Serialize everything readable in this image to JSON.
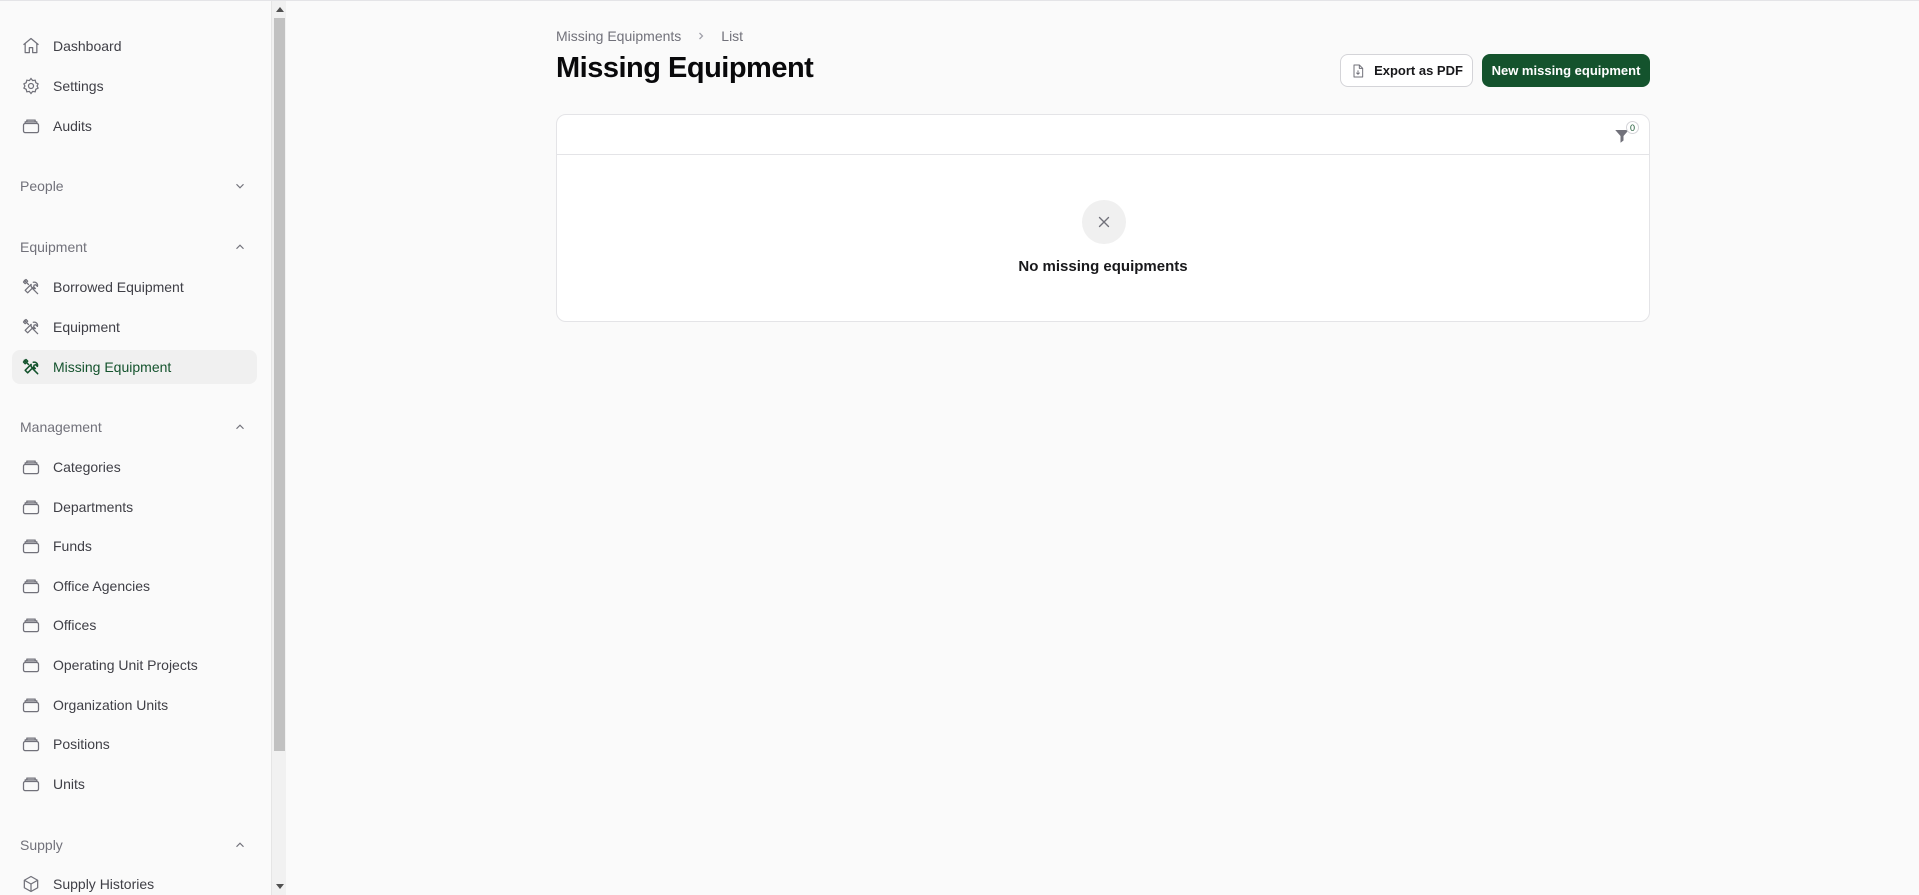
{
  "sidebar": {
    "top_items": [
      {
        "label": "Dashboard",
        "icon": "home-icon"
      },
      {
        "label": "Settings",
        "icon": "settings-icon"
      },
      {
        "label": "Audits",
        "icon": "stack-icon"
      }
    ],
    "groups": {
      "people": {
        "label": "People",
        "expanded": false
      },
      "equipment": {
        "label": "Equipment",
        "expanded": true,
        "items": [
          {
            "label": "Borrowed Equipment",
            "icon": "tools-icon"
          },
          {
            "label": "Equipment",
            "icon": "tools-icon"
          },
          {
            "label": "Missing Equipment",
            "icon": "tools-icon",
            "active": true
          }
        ]
      },
      "management": {
        "label": "Management",
        "expanded": true,
        "items": [
          {
            "label": "Categories",
            "icon": "stack-icon"
          },
          {
            "label": "Departments",
            "icon": "stack-icon"
          },
          {
            "label": "Funds",
            "icon": "stack-icon"
          },
          {
            "label": "Office Agencies",
            "icon": "stack-icon"
          },
          {
            "label": "Offices",
            "icon": "stack-icon"
          },
          {
            "label": "Operating Unit Projects",
            "icon": "stack-icon"
          },
          {
            "label": "Organization Units",
            "icon": "stack-icon"
          },
          {
            "label": "Positions",
            "icon": "stack-icon"
          },
          {
            "label": "Units",
            "icon": "stack-icon"
          }
        ]
      },
      "supply": {
        "label": "Supply",
        "expanded": true,
        "items": [
          {
            "label": "Supply Histories",
            "icon": "cube-icon"
          }
        ]
      }
    }
  },
  "breadcrumb": {
    "parent": "Missing Equipments",
    "current": "List"
  },
  "header": {
    "title": "Missing Equipment",
    "export_label": "Export as PDF",
    "new_label": "New missing equipment"
  },
  "table": {
    "filter_count": "0",
    "empty_message": "No missing equipments"
  },
  "colors": {
    "accent": "#14532d",
    "background": "#fafafa"
  }
}
